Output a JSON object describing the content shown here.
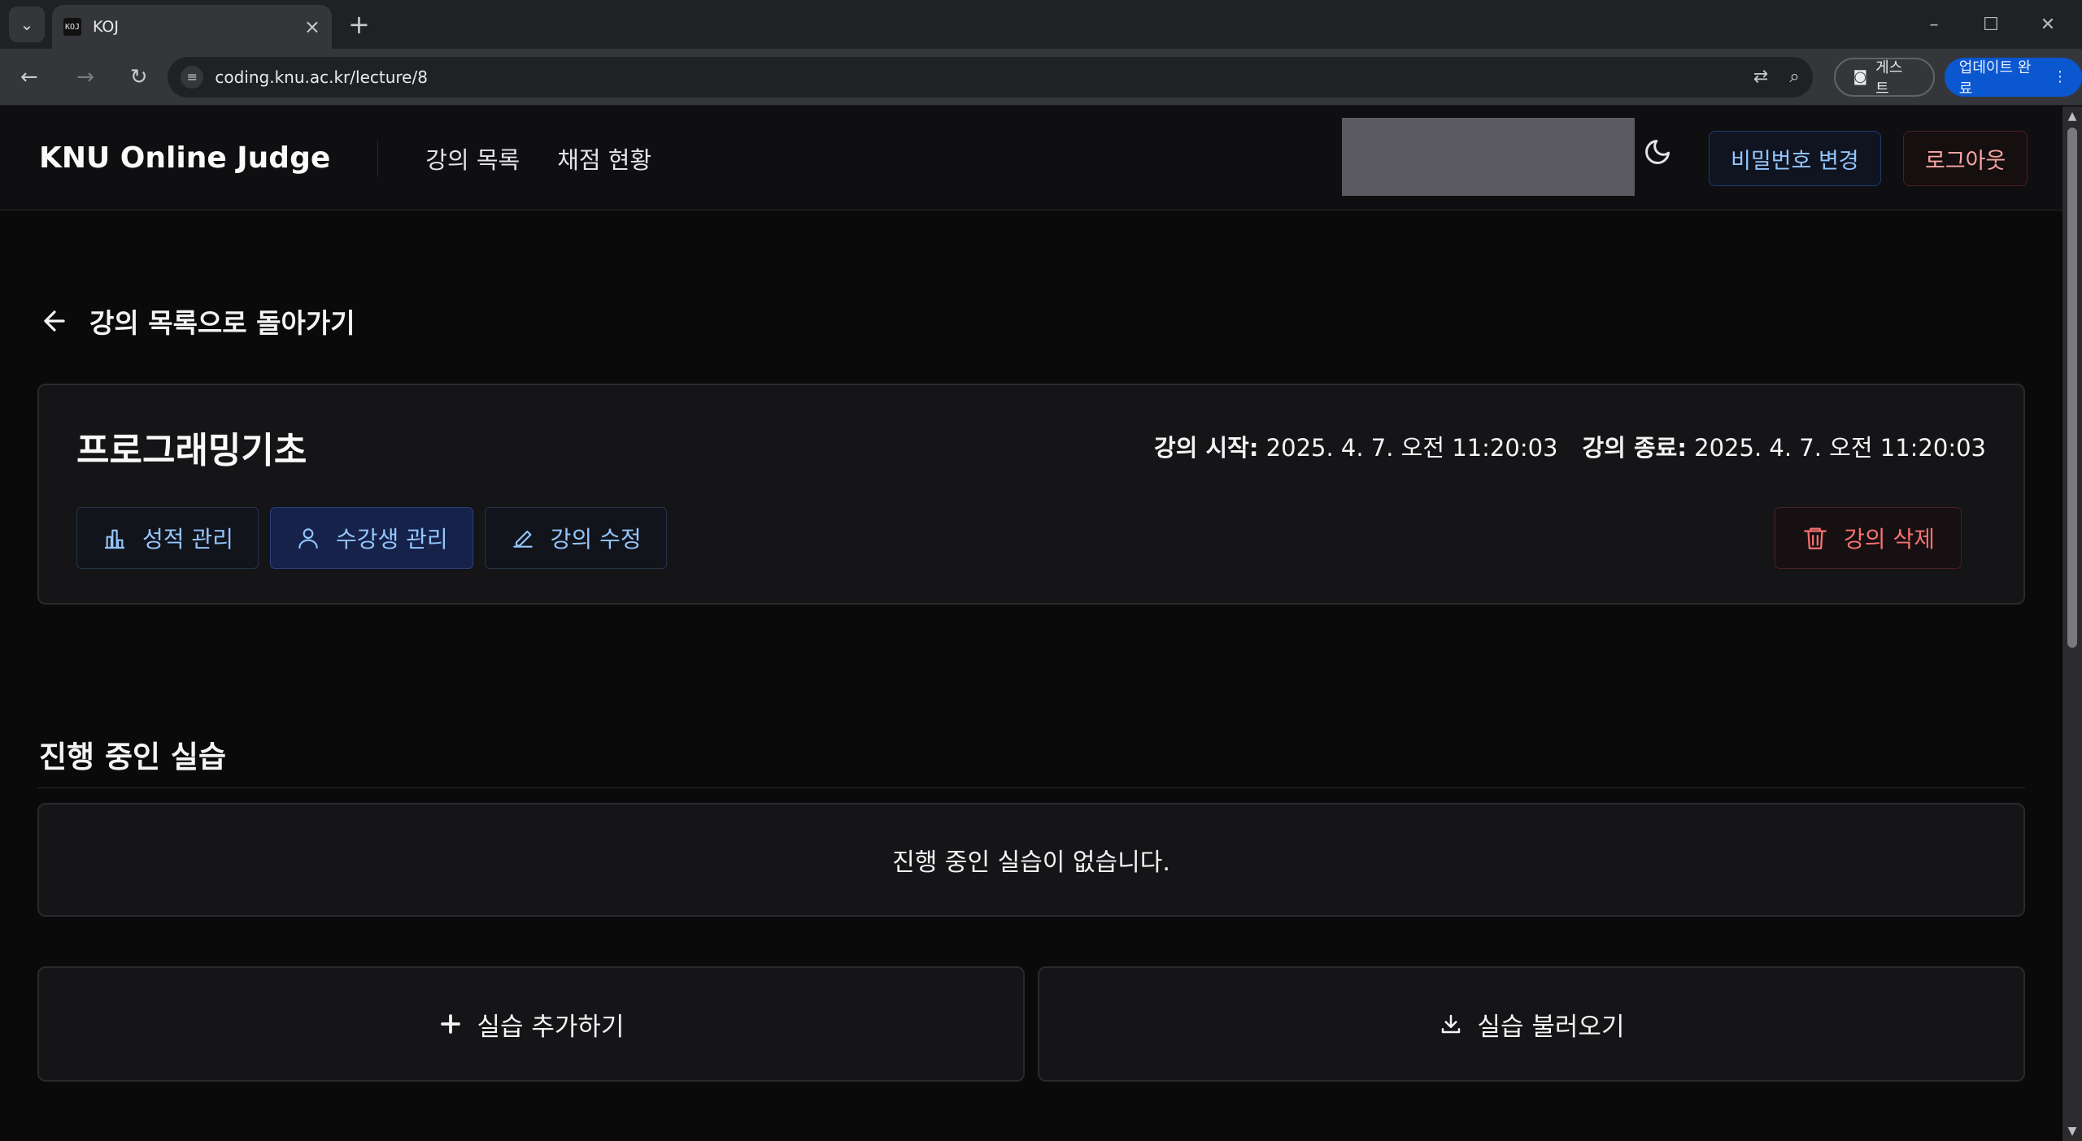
{
  "browser": {
    "tab_title": "KOJ",
    "favicon_text": "KOJ",
    "url": "coding.knu.ac.kr/lecture/8",
    "guest_label": "게스트",
    "update_label": "업데이트 완료"
  },
  "header": {
    "brand": "KNU Online Judge",
    "nav": [
      "강의 목록",
      "채점 현황"
    ],
    "change_password": "비밀번호 변경",
    "logout": "로그아웃"
  },
  "back_link": "강의 목록으로 돌아가기",
  "lecture": {
    "title": "프로그래밍기초",
    "start_label": "강의 시작:",
    "start_value": "2025. 4. 7. 오전 11:20:03",
    "end_label": "강의 종료:",
    "end_value": "2025. 4. 7. 오전 11:20:03",
    "actions": {
      "grades": "성적 관리",
      "students": "수강생 관리",
      "edit": "강의 수정",
      "delete": "강의 삭제"
    }
  },
  "practice": {
    "section_title": "진행 중인 실습",
    "empty_message": "진행 중인 실습이 없습니다.",
    "add_label": "실습 추가하기",
    "load_label": "실습 불러오기"
  },
  "colors": {
    "accent_blue": "#93c5fd",
    "danger_red": "#f87171",
    "background": "#0a0a0b",
    "card": "#151518"
  }
}
